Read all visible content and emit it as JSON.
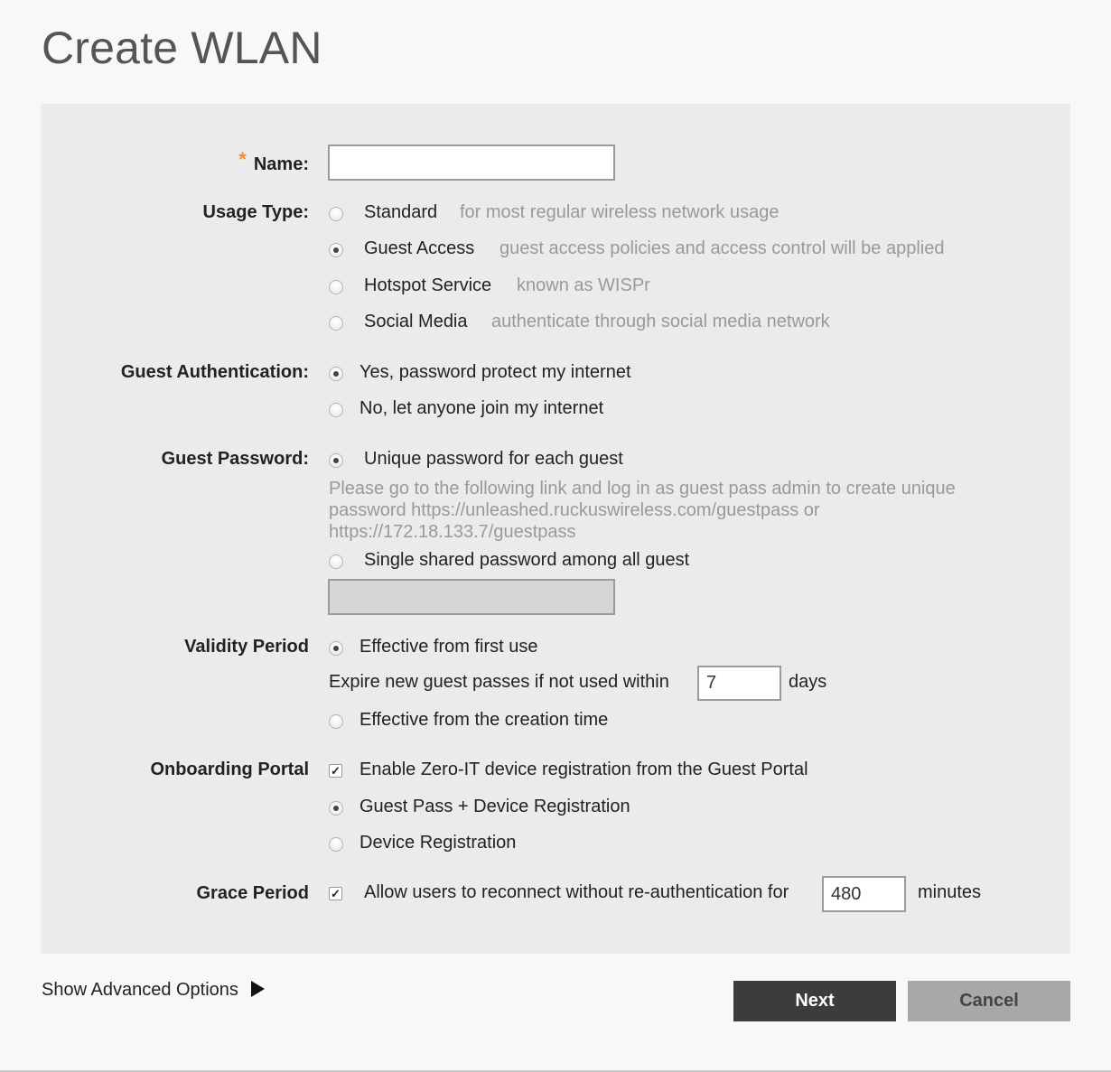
{
  "page": {
    "title": "Create WLAN"
  },
  "form": {
    "name": {
      "required_mark": "*",
      "label": "Name:",
      "value": ""
    },
    "usage_type": {
      "label": "Usage Type:",
      "options": [
        {
          "label": "Standard",
          "hint": "for most regular wireless network usage",
          "selected": false
        },
        {
          "label": "Guest Access",
          "hint": "guest access policies and access control will be applied",
          "selected": true
        },
        {
          "label": "Hotspot Service",
          "hint": "known as WISPr",
          "selected": false
        },
        {
          "label": "Social Media",
          "hint": "authenticate through social media network",
          "selected": false
        }
      ]
    },
    "guest_authentication": {
      "label": "Guest Authentication:",
      "options": [
        {
          "label": "Yes, password protect my internet",
          "selected": true
        },
        {
          "label": "No, let anyone join my internet",
          "selected": false
        }
      ]
    },
    "guest_password": {
      "label": "Guest Password:",
      "unique_label": "Unique password for each guest",
      "unique_selected": true,
      "unique_note": "Please go to the following link and log in as guest pass admin to create unique password https://unleashed.ruckuswireless.com/guestpass or https://172.18.133.7/guestpass",
      "shared_label": "Single shared password among all guest",
      "shared_selected": false,
      "shared_value": ""
    },
    "validity_period": {
      "label": "Validity Period",
      "first_use_label": "Effective from first use",
      "first_use_selected": true,
      "expire_prefix": "Expire new guest passes if not used within",
      "expire_value": "7",
      "expire_unit": "days",
      "creation_label": "Effective from the creation time",
      "creation_selected": false
    },
    "onboarding_portal": {
      "label": "Onboarding Portal",
      "enable_label": "Enable Zero-IT device registration from the Guest Portal",
      "enable_checked": true,
      "options": [
        {
          "label": "Guest Pass + Device Registration",
          "selected": true
        },
        {
          "label": "Device Registration",
          "selected": false
        }
      ]
    },
    "grace_period": {
      "label": "Grace Period",
      "checked": true,
      "prefix": "Allow users to reconnect without re-authentication for",
      "value": "480",
      "unit": "minutes"
    }
  },
  "footer": {
    "advanced_label": "Show Advanced Options",
    "next_label": "Next",
    "cancel_label": "Cancel"
  }
}
